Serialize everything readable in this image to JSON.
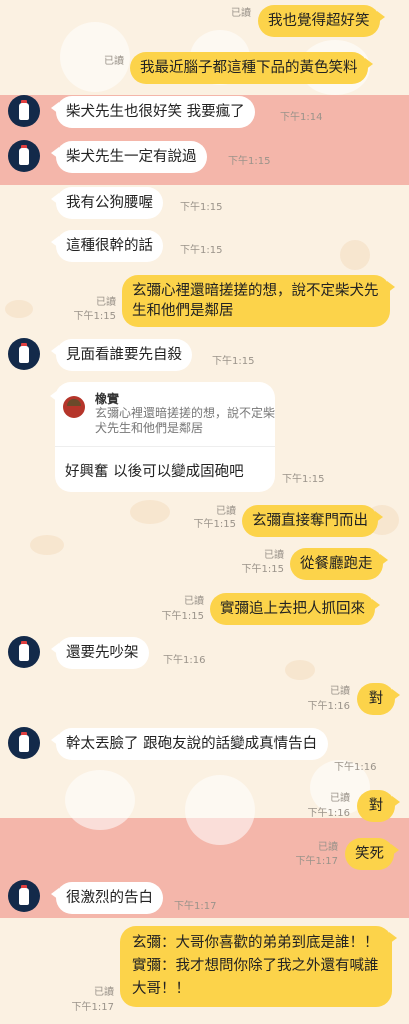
{
  "messages": [
    {
      "text": "我也覺得超好笑",
      "dir": "out",
      "read": "已讀"
    },
    {
      "text": "我最近腦子都這種下品的黃色笑料",
      "dir": "out",
      "read": "已讀"
    },
    {
      "text": "柴犬先生也很好笑 我要瘋了",
      "dir": "in",
      "time": "下午1:14"
    },
    {
      "text": "柴犬先生一定有說過",
      "dir": "in",
      "time": "下午1:15"
    },
    {
      "text": "我有公狗腰喔",
      "dir": "in",
      "time": "下午1:15"
    },
    {
      "text": "這種很幹的話",
      "dir": "in",
      "time": "下午1:15"
    },
    {
      "text": "玄彌心裡還暗搓搓的想，說不定柴犬先生和他們是鄰居",
      "dir": "out",
      "read": "已讀",
      "time": "下午1:15"
    },
    {
      "text": "見面看誰要先自殺",
      "dir": "in",
      "time": "下午1:15"
    },
    {
      "reply_name": "橡實",
      "reply_text": "玄彌心裡還暗搓搓的想，說不定柴犬先生和他們是鄰居",
      "text": "好興奮 以後可以變成固砲吧",
      "dir": "in",
      "time": "下午1:15"
    },
    {
      "text": "玄彌直接奪門而出",
      "dir": "out",
      "read": "已讀",
      "time": "下午1:15"
    },
    {
      "text": "從餐廳跑走",
      "dir": "out",
      "read": "已讀",
      "time": "下午1:15"
    },
    {
      "text": "實彌追上去把人抓回來",
      "dir": "out",
      "read": "已讀",
      "time": "下午1:15"
    },
    {
      "text": "還要先吵架",
      "dir": "in",
      "time": "下午1:16"
    },
    {
      "text": "對",
      "dir": "out",
      "read": "已讀",
      "time": "下午1:16"
    },
    {
      "text": "幹太丟臉了 跟砲友說的話變成真情告白",
      "dir": "in",
      "time": "下午1:16"
    },
    {
      "text": "對",
      "dir": "out",
      "read": "已讀",
      "time": "下午1:16"
    },
    {
      "text": "笑死",
      "dir": "out",
      "read": "已讀",
      "time": "下午1:17"
    },
    {
      "text": "很激烈的告白",
      "dir": "in",
      "time": "下午1:17"
    },
    {
      "text": "玄彌：大哥你喜歡的弟弟到底是誰！！\n實彌：我才想問你除了我之外還有喊誰大哥！！",
      "dir": "out",
      "read": "已讀",
      "time": "下午1:17"
    }
  ],
  "colors": {
    "outgoing": "#fcd34a",
    "incoming": "#ffffff",
    "band": "#f4b6aa",
    "background": "#fbf1e2",
    "avatar": "#132a4a"
  }
}
